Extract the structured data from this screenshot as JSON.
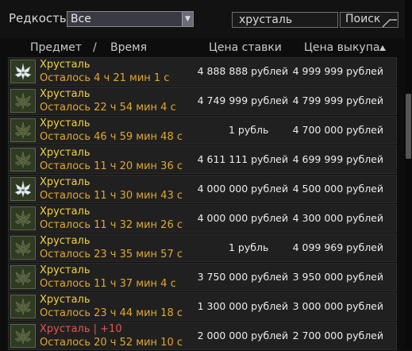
{
  "filters": {
    "rarity_label": "Редкость",
    "rarity_value": "Все",
    "search_value": "хрусталь",
    "search_button": "Поиск"
  },
  "headers": {
    "item": "Предмет",
    "sep": "/",
    "time": "Время",
    "bid": "Цена ставки",
    "buyout": "Цена выкупа"
  },
  "rows": [
    {
      "name": "Хрусталь",
      "time": "Осталось 4 ч 21 мин 1 с",
      "bid": "4 888 888 рублей",
      "buyout": "4 999 999 рублей",
      "icon": "crystal-white-icon"
    },
    {
      "name": "Хрусталь",
      "time": "Осталось 22 ч 54 мин 4 с",
      "bid": "4 749 999 рублей",
      "buyout": "4 799 999 рублей",
      "icon": "crystal-green-icon"
    },
    {
      "name": "Хрусталь",
      "time": "Осталось 46 ч 59 мин 48 с",
      "bid": "1 рубль",
      "buyout": "4 700 000 рублей",
      "icon": "crystal-green-icon"
    },
    {
      "name": "Хрусталь",
      "time": "Осталось 11 ч 20 мин 36 с",
      "bid": "4 611 111 рублей",
      "buyout": "4 699 999 рублей",
      "icon": "crystal-green-icon"
    },
    {
      "name": "Хрусталь",
      "time": "Осталось 11 ч 30 мин 43 с",
      "bid": "4 000 000 рублей",
      "buyout": "4 500 000 рублей",
      "icon": "crystal-white-icon"
    },
    {
      "name": "Хрусталь",
      "time": "Осталось 11 ч 32 мин 26 с",
      "bid": "4 000 000 рублей",
      "buyout": "4 300 000 рублей",
      "icon": "crystal-green-icon"
    },
    {
      "name": "Хрусталь",
      "time": "Осталось 23 ч 35 мин 57 с",
      "bid": "1 рубль",
      "buyout": "4 099 969 рублей",
      "icon": "crystal-green-icon"
    },
    {
      "name": "Хрусталь",
      "time": "Осталось 11 ч 37 мин 4 с",
      "bid": "3 750 000 рублей",
      "buyout": "3 950 000 рублей",
      "icon": "crystal-green-icon"
    },
    {
      "name": "Хрусталь",
      "time": "Осталось 23 ч 44 мин 18 с",
      "bid": "1 300 000 рублей",
      "buyout": "3 000 000 рублей",
      "icon": "crystal-green-icon"
    },
    {
      "name": "Хрусталь | +10",
      "time": "Осталось 20 ч 52 мин 10 с",
      "bid": "2 000 000 рублей",
      "buyout": "2 700 000 рублей",
      "icon": "crystal-green-icon",
      "rare": true
    }
  ],
  "colors": {
    "item_name": "#f2d040",
    "time_left": "#e0a82e",
    "enhanced_item_name": "#e6554e"
  }
}
